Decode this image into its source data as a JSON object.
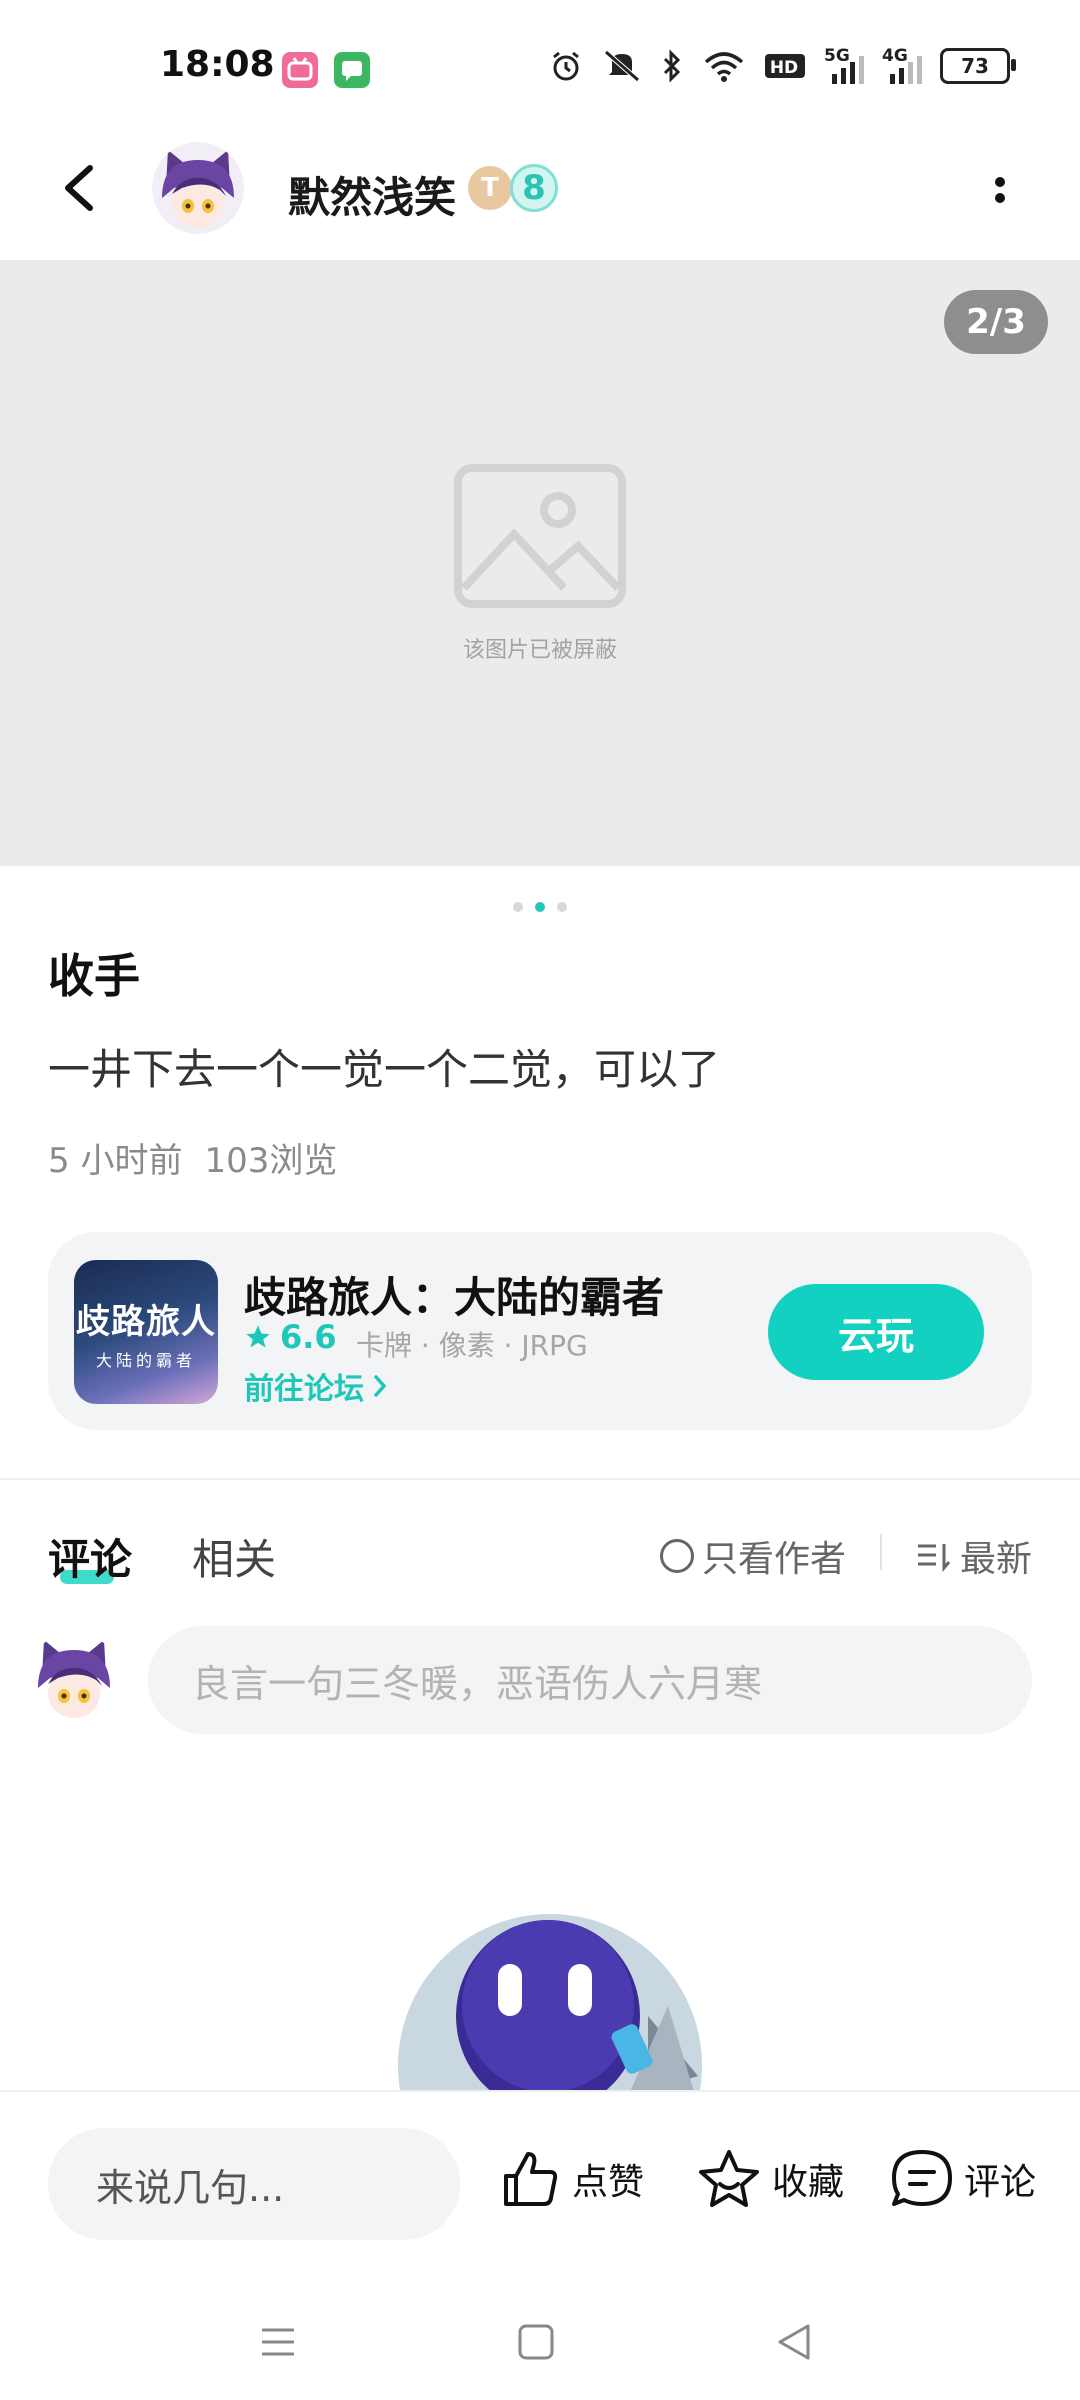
{
  "status_bar": {
    "time": "18:08",
    "network_5g": "5G",
    "network_4g": "4G",
    "battery": "73",
    "icons": [
      "bilibili-app-icon",
      "message-app-icon",
      "alarm-icon",
      "mute-icon",
      "bluetooth-icon",
      "wifi-icon",
      "hd-icon",
      "signal-5g-icon",
      "signal-4g-icon",
      "battery-icon"
    ]
  },
  "header": {
    "user_name": "默然浅笑",
    "badge_letter": "T",
    "badge_level": "8",
    "back_icon": "chevron-left-icon",
    "more_icon": "more-vertical-icon"
  },
  "image_viewer": {
    "counter": "2/3",
    "blocked_text": "该图片已被屏蔽",
    "pages": 3,
    "active_page": 2
  },
  "post": {
    "title": "收手",
    "body": "一井下去一个一觉一个二觉，可以了",
    "time": "5 小时前",
    "views": "103浏览"
  },
  "game_card": {
    "icon_title": "歧路旅人",
    "icon_subtitle": "大陆的霸者",
    "name": "歧路旅人：大陆的霸者",
    "rating": "6.6",
    "tags": "卡牌 · 像素 · JRPG",
    "forum_link": "前往论坛",
    "cloud_play_button": "云玩"
  },
  "comments_section": {
    "tabs": [
      "评论",
      "相关"
    ],
    "active_tab": "评论",
    "only_author": "只看作者",
    "sort": "最新",
    "input_placeholder": "良言一句三冬暖，恶语伤人六月寒"
  },
  "bottom_bar": {
    "input_placeholder": "来说几句...",
    "like": "点赞",
    "favorite": "收藏",
    "comment": "评论"
  },
  "colors": {
    "accent": "#13d1c1",
    "image_bg": "#ebebeb",
    "card_bg": "#f3f4f6"
  }
}
